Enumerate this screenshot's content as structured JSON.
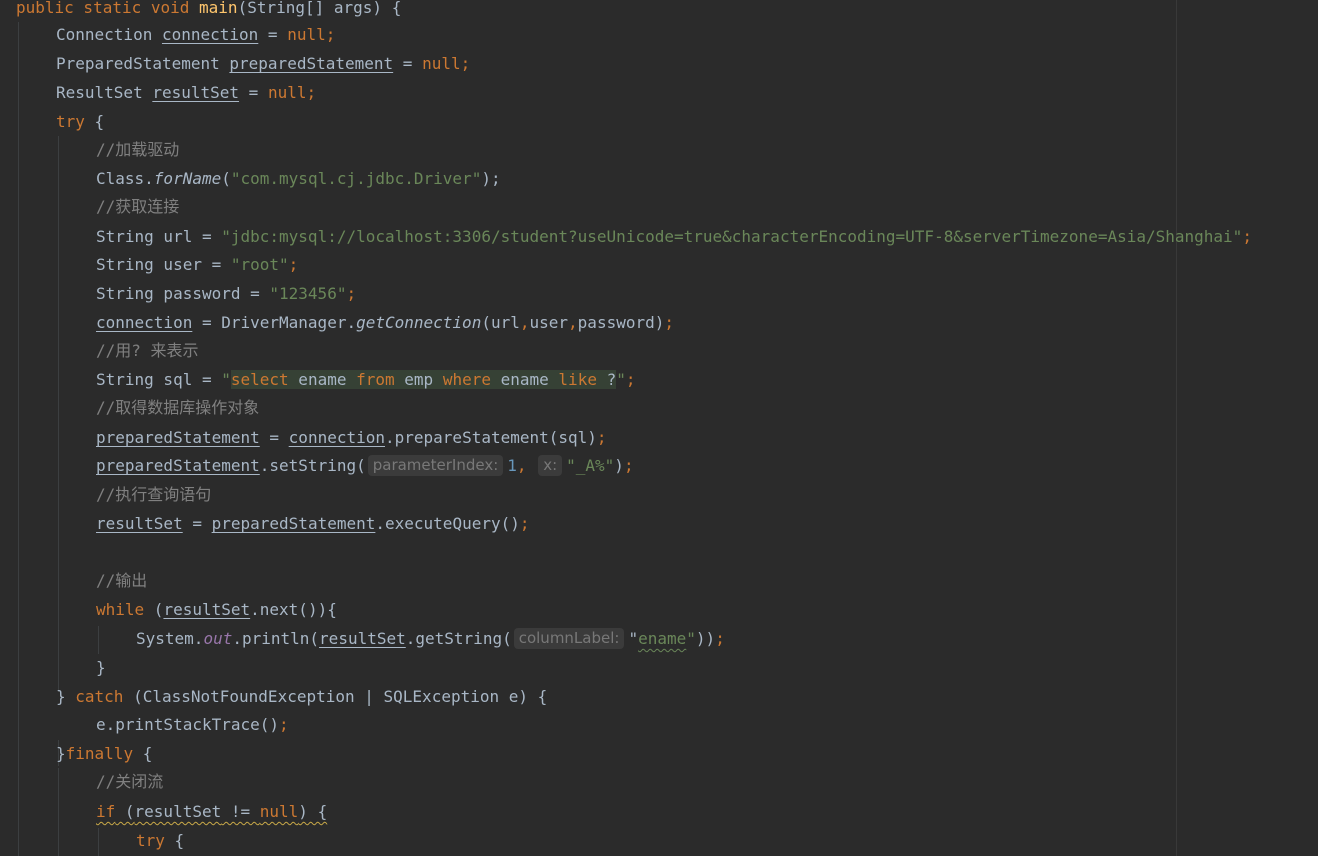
{
  "theme": {
    "background": "#2b2b2b",
    "text": "#a9b7c6",
    "keyword": "#cc7832",
    "string": "#6a8759",
    "comment": "#808080",
    "method_decl": "#ffc66d",
    "number": "#6897bb",
    "static_field": "#9876aa"
  },
  "code": {
    "lines": [
      {
        "tokens": [
          {
            "t": "public static void ",
            "c": "kw"
          },
          {
            "t": "main",
            "c": "fn"
          },
          {
            "t": "(String[] args) {"
          }
        ]
      },
      {
        "tokens": [
          {
            "t": "Connection "
          },
          {
            "t": "connection",
            "c": "ul"
          },
          {
            "t": " = "
          },
          {
            "t": "null;",
            "c": "kw"
          }
        ]
      },
      {
        "tokens": [
          {
            "t": "PreparedStatement "
          },
          {
            "t": "preparedStatement",
            "c": "ul"
          },
          {
            "t": " = "
          },
          {
            "t": "null;",
            "c": "kw"
          }
        ]
      },
      {
        "tokens": [
          {
            "t": "ResultSet "
          },
          {
            "t": "resultSet",
            "c": "ul"
          },
          {
            "t": " = "
          },
          {
            "t": "null;",
            "c": "kw"
          }
        ]
      },
      {
        "tokens": [
          {
            "t": "try",
            "c": "kw"
          },
          {
            "t": " {"
          }
        ]
      },
      {
        "tokens": [
          {
            "t": "//加载驱动",
            "c": "cmt"
          }
        ]
      },
      {
        "tokens": [
          {
            "t": "Class."
          },
          {
            "t": "forName",
            "c": "italic"
          },
          {
            "t": "("
          },
          {
            "t": "\"com.mysql.cj.jdbc.Driver\"",
            "c": "str"
          },
          {
            "t": ");"
          }
        ]
      },
      {
        "tokens": [
          {
            "t": "//获取连接",
            "c": "cmt"
          }
        ]
      },
      {
        "tokens": [
          {
            "t": "String url = "
          },
          {
            "t": "\"jdbc:mysql://localhost:3306/student?useUnicode=true&characterEncoding=UTF-8&serverTimezone=Asia/Shanghai\"",
            "c": "str"
          },
          {
            "t": ";",
            "c": "kw"
          }
        ]
      },
      {
        "tokens": [
          {
            "t": "String user = "
          },
          {
            "t": "\"root\"",
            "c": "str"
          },
          {
            "t": ";",
            "c": "kw"
          }
        ]
      },
      {
        "tokens": [
          {
            "t": "String password = "
          },
          {
            "t": "\"123456\"",
            "c": "str"
          },
          {
            "t": ";",
            "c": "kw"
          }
        ]
      },
      {
        "tokens": [
          {
            "t": "connection",
            "c": "ul"
          },
          {
            "t": " = DriverManager."
          },
          {
            "t": "getConnection",
            "c": "italic"
          },
          {
            "t": "(url"
          },
          {
            "t": ",",
            "c": "kw"
          },
          {
            "t": "user"
          },
          {
            "t": ",",
            "c": "kw"
          },
          {
            "t": "password)"
          },
          {
            "t": ";",
            "c": "kw"
          }
        ]
      },
      {
        "tokens": [
          {
            "t": "//用? 来表示",
            "c": "cmt"
          }
        ]
      },
      {
        "tokens": [
          {
            "t": "String sql = "
          },
          {
            "t": "\"",
            "c": "str"
          },
          {
            "t": "select",
            "c": "kw inj"
          },
          {
            "t": " ename ",
            "c": "inj"
          },
          {
            "t": "from",
            "c": "kw inj"
          },
          {
            "t": " emp ",
            "c": "inj"
          },
          {
            "t": "where",
            "c": "kw inj"
          },
          {
            "t": " ename ",
            "c": "inj"
          },
          {
            "t": "like",
            "c": "kw inj"
          },
          {
            "t": " ?",
            "c": "inj"
          },
          {
            "t": "\"",
            "c": "str"
          },
          {
            "t": ";",
            "c": "kw"
          }
        ]
      },
      {
        "tokens": [
          {
            "t": "//取得数据库操作对象",
            "c": "cmt"
          }
        ]
      },
      {
        "tokens": [
          {
            "t": "preparedStatement",
            "c": "ul"
          },
          {
            "t": " = "
          },
          {
            "t": "connection",
            "c": "ul"
          },
          {
            "t": ".prepareStatement(sql)"
          },
          {
            "t": ";",
            "c": "kw"
          }
        ]
      },
      {
        "tokens": [
          {
            "t": "preparedStatement",
            "c": "ul"
          },
          {
            "t": ".setString("
          },
          {
            "t": "parameterIndex:",
            "c": "hint"
          },
          {
            "t": "1",
            "c": "num"
          },
          {
            "t": ", ",
            "c": "kw"
          },
          {
            "t": "x:",
            "c": "hint"
          },
          {
            "t": "\"_A%\"",
            "c": "str"
          },
          {
            "t": ")"
          },
          {
            "t": ";",
            "c": "kw"
          }
        ]
      },
      {
        "tokens": [
          {
            "t": "//执行查询语句",
            "c": "cmt"
          }
        ]
      },
      {
        "tokens": [
          {
            "t": "resultSet",
            "c": "ul"
          },
          {
            "t": " = "
          },
          {
            "t": "preparedStatement",
            "c": "ul"
          },
          {
            "t": ".executeQuery()"
          },
          {
            "t": ";",
            "c": "kw"
          }
        ]
      },
      {
        "tokens": []
      },
      {
        "tokens": [
          {
            "t": "//输出",
            "c": "cmt"
          }
        ]
      },
      {
        "tokens": [
          {
            "t": "while",
            "c": "kw"
          },
          {
            "t": " ("
          },
          {
            "t": "resultSet",
            "c": "ul"
          },
          {
            "t": ".next()){"
          }
        ]
      },
      {
        "tokens": [
          {
            "t": "System."
          },
          {
            "t": "out",
            "c": "static"
          },
          {
            "t": ".println("
          },
          {
            "t": "resultSet",
            "c": "ul"
          },
          {
            "t": ".getString("
          },
          {
            "t": "columnLabel:",
            "c": "hint"
          },
          {
            "t": "\""
          },
          {
            "t": "ename",
            "c": "str squig-g"
          },
          {
            "t": "\"",
            "c": "str"
          },
          {
            "t": "))"
          },
          {
            "t": ";",
            "c": "kw"
          }
        ]
      },
      {
        "tokens": [
          {
            "t": "}"
          }
        ]
      },
      {
        "tokens": [
          {
            "t": "} "
          },
          {
            "t": "catch",
            "c": "kw"
          },
          {
            "t": " (ClassNotFoundException | SQLException e) {"
          }
        ]
      },
      {
        "tokens": [
          {
            "t": "e.printStackTrace()"
          },
          {
            "t": ";",
            "c": "kw"
          }
        ]
      },
      {
        "tokens": [
          {
            "t": "}"
          },
          {
            "t": "finally",
            "c": "kw"
          },
          {
            "t": " {"
          }
        ]
      },
      {
        "tokens": [
          {
            "t": "//关闭流",
            "c": "cmt"
          }
        ]
      },
      {
        "tokens": [
          {
            "t": "if",
            "c": "kw squig"
          },
          {
            "t": " (",
            "c": "squig"
          },
          {
            "t": "resultSet",
            "c": "ul squig"
          },
          {
            "t": " != ",
            "c": "squig"
          },
          {
            "t": "null",
            "c": "kw squig"
          },
          {
            "t": ") {",
            "c": "squig"
          }
        ]
      },
      {
        "tokens": [
          {
            "t": "try",
            "c": "kw"
          },
          {
            "t": " {"
          }
        ]
      }
    ]
  }
}
